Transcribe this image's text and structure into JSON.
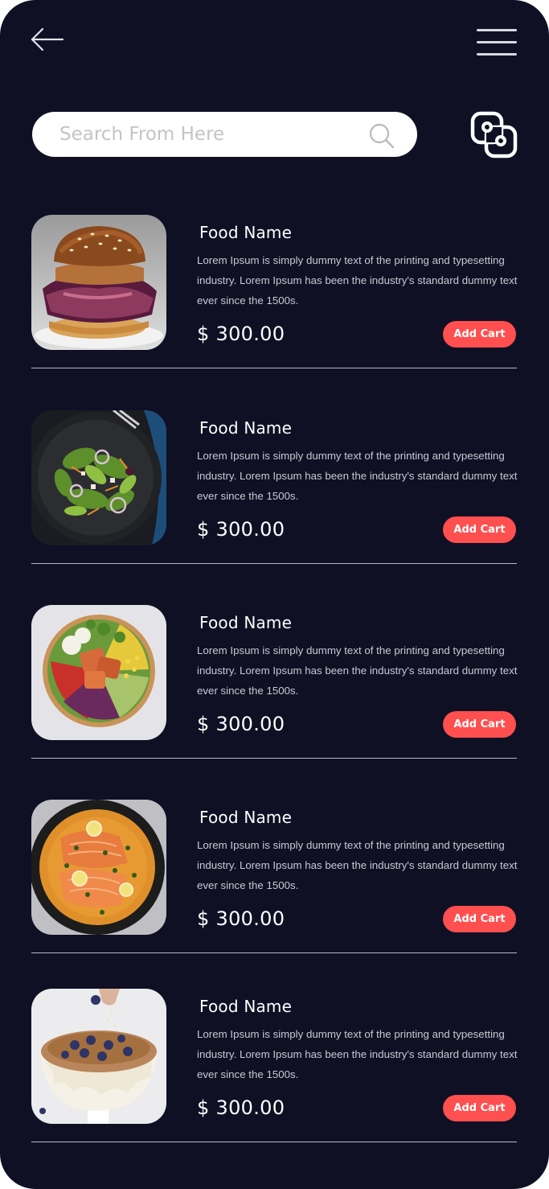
{
  "header": {
    "back_icon": "arrow-left-icon",
    "menu_icon": "hamburger-menu-icon",
    "scan_icon": "scan-icon"
  },
  "search": {
    "placeholder": "Search From Here",
    "icon": "search-icon"
  },
  "colors": {
    "background": "#0f1024",
    "accent": "#ff4f4f",
    "text": "#ffffff"
  },
  "items": [
    {
      "name": "Food Name",
      "image": "burger",
      "description": "Lorem Ipsum is simply dummy text of the printing and typesetting industry. Lorem Ipsum has been the industry's standard dummy text ever since the 1500s.",
      "price": "$ 300.00",
      "button": "Add Cart"
    },
    {
      "name": "Food Name",
      "image": "green salad",
      "description": "Lorem Ipsum is simply dummy text of the printing and typesetting industry. Lorem Ipsum has been the industry's standard dummy text ever since the 1500s.",
      "price": "$ 300.00",
      "button": "Add Cart"
    },
    {
      "name": "Food Name",
      "image": "salmon salad bowl",
      "description": "Lorem Ipsum is simply dummy text of the printing and typesetting industry. Lorem Ipsum has been the industry's standard dummy text ever since the 1500s.",
      "price": "$ 300.00",
      "button": "Add Cart"
    },
    {
      "name": "Food Name",
      "image": "salmon curry",
      "description": "Lorem Ipsum is simply dummy text of the printing and typesetting industry. Lorem Ipsum has been the industry's standard dummy text ever since the 1500s.",
      "price": "$ 300.00",
      "button": "Add Cart"
    },
    {
      "name": "Food Name",
      "image": "blueberry cake",
      "description": "Lorem Ipsum is simply dummy text of the printing and typesetting industry. Lorem Ipsum has been the industry's standard dummy text ever since the 1500s.",
      "price": "$ 300.00",
      "button": "Add Cart"
    }
  ]
}
